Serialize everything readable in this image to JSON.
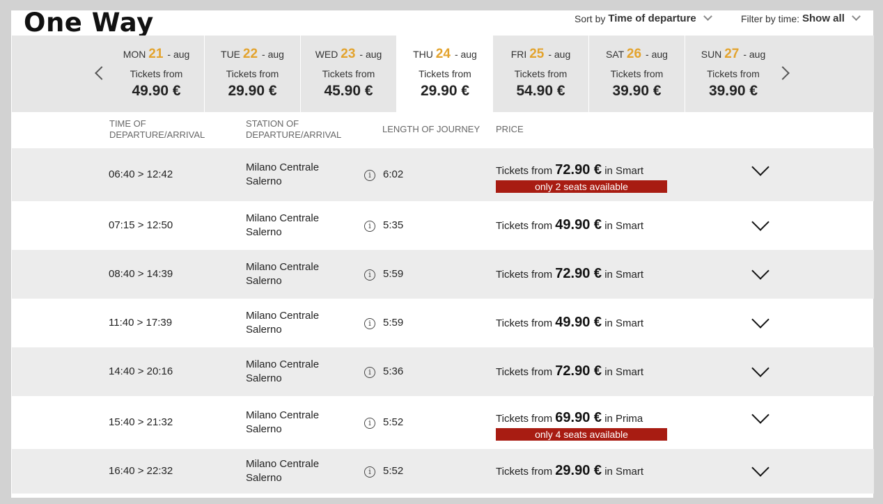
{
  "page": {
    "title": "One Way"
  },
  "controls": {
    "sort_label": "Sort by",
    "sort_value": "Time of departure",
    "filter_label": "Filter by time:",
    "filter_value": "Show all"
  },
  "dates": [
    {
      "dow": "MON",
      "day": "21",
      "month": "- aug",
      "tickets_from": "Tickets from",
      "price": "49.90 €"
    },
    {
      "dow": "TUE",
      "day": "22",
      "month": "- aug",
      "tickets_from": "Tickets from",
      "price": "29.90 €"
    },
    {
      "dow": "WED",
      "day": "23",
      "month": "- aug",
      "tickets_from": "Tickets from",
      "price": "45.90 €"
    },
    {
      "dow": "THU",
      "day": "24",
      "month": "- aug",
      "tickets_from": "Tickets from",
      "price": "29.90 €"
    },
    {
      "dow": "FRI",
      "day": "25",
      "month": "- aug",
      "tickets_from": "Tickets from",
      "price": "54.90 €"
    },
    {
      "dow": "SAT",
      "day": "26",
      "month": "- aug",
      "tickets_from": "Tickets from",
      "price": "39.90 €"
    },
    {
      "dow": "SUN",
      "day": "27",
      "month": "- aug",
      "tickets_from": "Tickets from",
      "price": "39.90 €"
    }
  ],
  "selected_date_index": 3,
  "columns": {
    "time_1": "TIME OF",
    "time_2": "DEPARTURE/ARRIVAL",
    "station_1": "STATION OF",
    "station_2": "DEPARTURE/ARRIVAL",
    "length": "LENGTH OF JOURNEY",
    "price": "PRICE"
  },
  "trains": [
    {
      "time": "06:40 > 12:42",
      "from": "Milano Centrale",
      "to": "Salerno",
      "duration": "6:02",
      "tickets_from": "Tickets from",
      "price": "72.90 €",
      "in_class": "in Smart",
      "seats": "only 2 seats available"
    },
    {
      "time": "07:15 > 12:50",
      "from": "Milano Centrale",
      "to": "Salerno",
      "duration": "5:35",
      "tickets_from": "Tickets from",
      "price": "49.90 €",
      "in_class": "in Smart",
      "seats": ""
    },
    {
      "time": "08:40 > 14:39",
      "from": "Milano Centrale",
      "to": "Salerno",
      "duration": "5:59",
      "tickets_from": "Tickets from",
      "price": "72.90 €",
      "in_class": "in Smart",
      "seats": ""
    },
    {
      "time": "11:40 > 17:39",
      "from": "Milano Centrale",
      "to": "Salerno",
      "duration": "5:59",
      "tickets_from": "Tickets from",
      "price": "49.90 €",
      "in_class": "in Smart",
      "seats": ""
    },
    {
      "time": "14:40 > 20:16",
      "from": "Milano Centrale",
      "to": "Salerno",
      "duration": "5:36",
      "tickets_from": "Tickets from",
      "price": "72.90 €",
      "in_class": "in Smart",
      "seats": ""
    },
    {
      "time": "15:40 > 21:32",
      "from": "Milano Centrale",
      "to": "Salerno",
      "duration": "5:52",
      "tickets_from": "Tickets from",
      "price": "69.90 €",
      "in_class": "in Prima",
      "seats": "only 4 seats available"
    },
    {
      "time": "16:40 > 22:32",
      "from": "Milano Centrale",
      "to": "Salerno",
      "duration": "5:52",
      "tickets_from": "Tickets from",
      "price": "29.90 €",
      "in_class": "in Smart",
      "seats": ""
    }
  ],
  "icons": {
    "prev": "chevron-left-icon",
    "next": "chevron-right-icon",
    "info": "info-icon",
    "expand": "chevron-down-icon"
  },
  "colors": {
    "date_accent": "#e3a32d",
    "seats_badge": "#a81c12",
    "row_shade": "#ececec",
    "date_bar": "#e6e6e6"
  }
}
